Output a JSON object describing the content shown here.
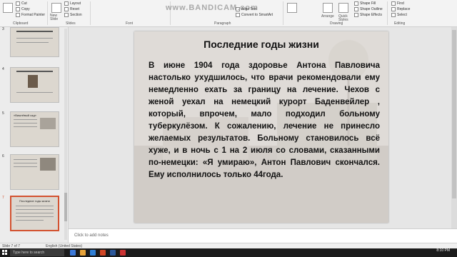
{
  "watermark": "www.BANDICAM.com",
  "ribbon": {
    "clipboard": {
      "cut": "Cut",
      "copy": "Copy",
      "format_painter": "Format Painter",
      "group": "Clipboard"
    },
    "slides": {
      "new_slide": "New",
      "new_slide2": "Slide",
      "layout": "Layout",
      "reset": "Reset",
      "section": "Section",
      "group": "Slides"
    },
    "font_group": "Font",
    "paragraph": {
      "align_text": "Align Text",
      "smartart": "Convert to SmartArt",
      "group": "Paragraph"
    },
    "drawing": {
      "arrange": "Arrange",
      "quick_styles1": "Quick",
      "quick_styles2": "Styles",
      "shape_fill": "Shape Fill",
      "shape_outline": "Shape Outline",
      "shape_effects": "Shape Effects",
      "group": "Drawing"
    },
    "editing": {
      "find": "Find",
      "replace": "Replace",
      "select": "Select",
      "group": "Editing"
    }
  },
  "thumbnails": [
    {
      "num": "3"
    },
    {
      "num": "4"
    },
    {
      "num": "5",
      "caption": "«Вишнёвый сад»"
    },
    {
      "num": "6"
    },
    {
      "num": "7",
      "caption": "Последние годы жизни"
    }
  ],
  "slide": {
    "title": "Последние годы жизни",
    "body": "В июне 1904 года здоровье Антона Павловича настолько ухудшилось, что врачи рекомендовали ему немедленно ехать за границу на лечение. Чехов с женой уехал на немецкий курорт Баденвейлер , который, впрочем, мало подходил больному туберкулёзом. К сожалению, лечение не принесло желаемых результатов. Больному становилось всё хуже, и в ночь с 1 на 2 июля со словами, сказанными по-немецки: «Я умираю», Антон Павлович скончался. Ему исполнилось только 44года."
  },
  "notes_placeholder": "Click to add notes",
  "status": {
    "slide_count": "Slide 7 of 7",
    "language": "English (United States)"
  },
  "taskbar": {
    "time": "8:10 PM",
    "search_placeholder": "Type here to search"
  },
  "colors": {
    "selection": "#d35230",
    "slide_bg": "#dfdbd7"
  }
}
